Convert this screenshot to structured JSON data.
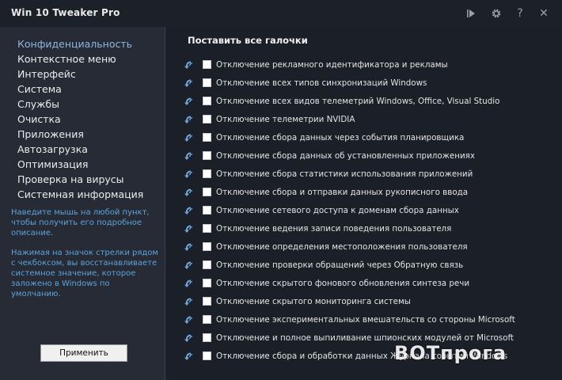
{
  "window": {
    "title": "Win 10 Tweaker Pro",
    "icons": [
      "play-skip-icon",
      "gear-icon",
      "help-icon",
      "close-icon"
    ],
    "help_symbol": "?",
    "close_symbol": "✕"
  },
  "sidebar": {
    "items": [
      {
        "label": "Конфиденциальность",
        "active": true
      },
      {
        "label": "Контекстное меню"
      },
      {
        "label": "Интерфейс"
      },
      {
        "label": "Система"
      },
      {
        "label": "Службы"
      },
      {
        "label": "Очистка"
      },
      {
        "label": "Приложения"
      },
      {
        "label": "Автозагрузка"
      },
      {
        "label": "Оптимизация"
      },
      {
        "label": "Проверка на вирусы"
      },
      {
        "label": "Системная информация"
      }
    ],
    "help_text_1": "Наведите мышь на любой пункт, чтобы получить его подробное описание.",
    "help_text_2": "Нажимая на значок стрелки рядом с чекбоксом, вы восстанавливаете системное значение, которое заложено в Windows по умолчанию.",
    "apply_label": "Применить"
  },
  "main": {
    "select_all_label": "Поставить все галочки",
    "options": [
      {
        "label": "Отключение рекламного идентификатора и рекламы",
        "checked": false
      },
      {
        "label": "Отключение всех типов синхронизаций Windows",
        "checked": false
      },
      {
        "label": "Отключение всех видов телеметрий Windows, Office, Visual Studio",
        "checked": false
      },
      {
        "label": "Отключение телеметрии NVIDIA",
        "checked": false
      },
      {
        "label": "Отключение сбора данных через события планировщика",
        "checked": false
      },
      {
        "label": "Отключение сбора данных об установленных приложениях",
        "checked": false
      },
      {
        "label": "Отключение сбора статистики использования приложений",
        "checked": false
      },
      {
        "label": "Отключение сбора и отправки данных рукописного ввода",
        "checked": false
      },
      {
        "label": "Отключение сетевого доступа к доменам сбора данных",
        "checked": false
      },
      {
        "label": "Отключение ведения записи поведения пользователя",
        "checked": false
      },
      {
        "label": "Отключение определения местоположения пользователя",
        "checked": false
      },
      {
        "label": "Отключение проверки обращений через Обратную связь",
        "checked": false
      },
      {
        "label": "Отключение скрытого фонового обновления синтеза речи",
        "checked": false
      },
      {
        "label": "Отключение скрытого мониторинга системы",
        "checked": false
      },
      {
        "label": "Отключение экспериментальных вмешательств со стороны Microsoft",
        "checked": false
      },
      {
        "label": "Отключение и полное выпиливание шпионских модулей от Microsoft",
        "checked": false
      },
      {
        "label": "Отключение сбора и обработки данных Журнала событий Windows",
        "checked": false
      }
    ]
  },
  "watermark": {
    "text": "BOTпрога"
  },
  "colors": {
    "background": "#1b1f27",
    "sidebar": "#262b35",
    "active_item": "#8fb6e0",
    "help_text": "#5fa3dc",
    "restore_icon": "#6ea8e0"
  }
}
